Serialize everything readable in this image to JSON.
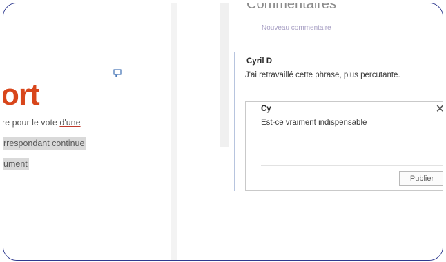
{
  "document": {
    "title_fragment": "ort",
    "lines": [
      {
        "before": "re pour le vote ",
        "underlined": "d'une",
        "after": ""
      },
      {
        "highlight": "rrespondant continue"
      },
      {
        "highlight": "ument"
      }
    ]
  },
  "comments_pane": {
    "title": "Commentaires",
    "new_comment_label": "Nouveau commentaire",
    "thread": {
      "author": "Cyril D",
      "text": "J'ai retravaillé cette phrase, plus percutante."
    },
    "reply": {
      "author": "Cy",
      "text": "Est-ce vraiment indispensable",
      "close_icon": "close-icon",
      "publish_label": "Publier"
    }
  },
  "colors": {
    "accent_title": "#d8461b",
    "frame_border": "#2f3a8f",
    "thread_bar": "#b7c4de"
  }
}
